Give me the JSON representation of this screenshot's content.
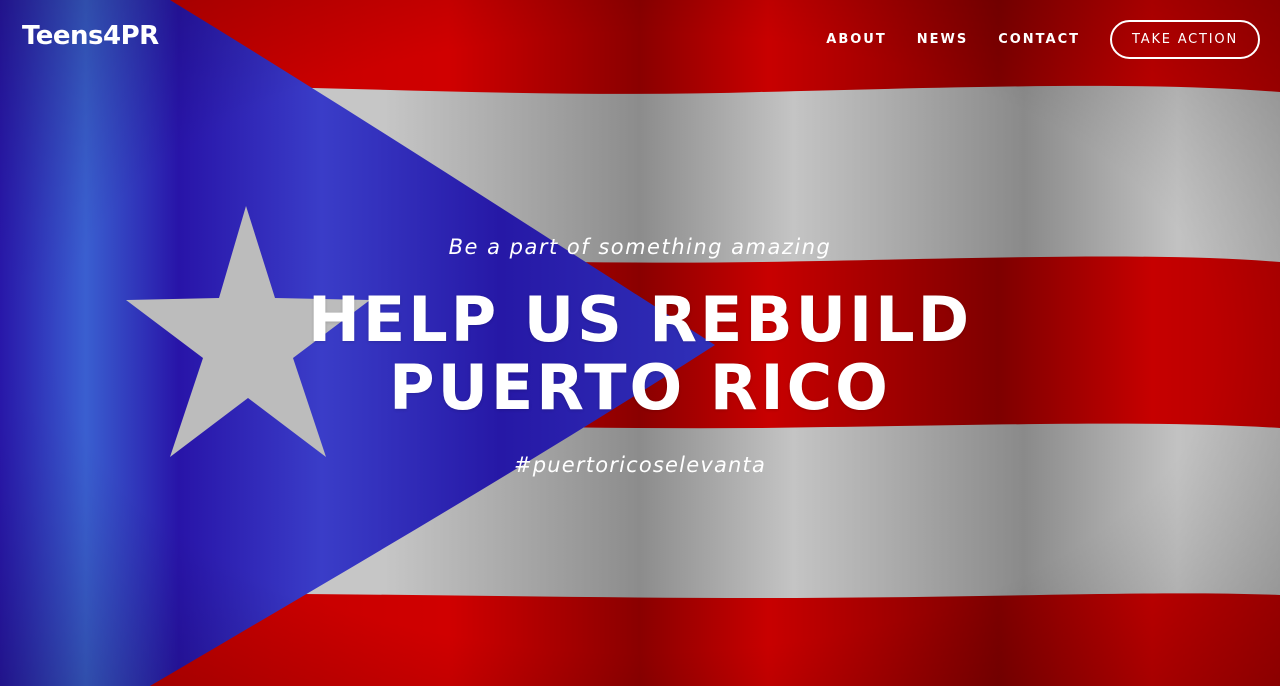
{
  "brand": {
    "logo_text": "Teens4PR"
  },
  "nav": {
    "items": [
      {
        "label": "ABOUT"
      },
      {
        "label": "NEWS"
      },
      {
        "label": "CONTACT"
      }
    ],
    "cta_label": "TAKE ACTION"
  },
  "hero": {
    "tagline": "Be a part of something amazing",
    "headline_line1": "HELP US REBUILD",
    "headline_line2": "PUERTO RICO",
    "hashtag": "#puertoricoselevanta"
  },
  "colors": {
    "flag_red": "#c00000",
    "flag_white": "#bdbdbd",
    "flag_blue": "#2a1fb5",
    "text": "#ffffff"
  },
  "icons": {
    "flag_star": "star-icon"
  }
}
